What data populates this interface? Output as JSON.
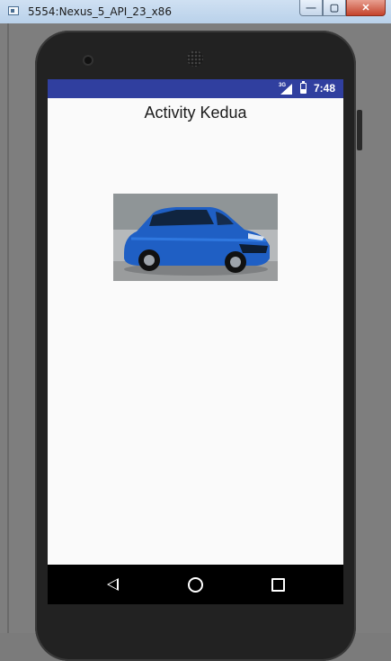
{
  "window": {
    "title": "5554:Nexus_5_API_23_x86",
    "buttons": {
      "minimize": "—",
      "maximize": "▢",
      "close": "✕"
    }
  },
  "status_bar": {
    "network": "3G",
    "time": "7:48",
    "color": "#303f9f"
  },
  "activity": {
    "title": "Activity Kedua",
    "image": "blue-hatchback-car-photo"
  },
  "navigation": {
    "back": "back-icon",
    "home": "home-icon",
    "recents": "recents-icon"
  }
}
